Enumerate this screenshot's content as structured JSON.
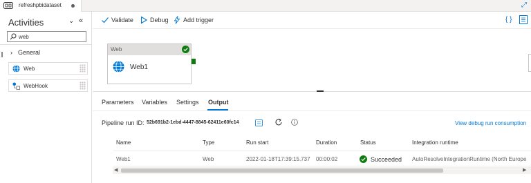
{
  "tab": {
    "title": "refreshpbidataset"
  },
  "activities": {
    "title": "Activities",
    "search_value": "web",
    "group_label": "General",
    "items": [
      {
        "label": "Web",
        "icon": "globe-icon"
      },
      {
        "label": "WebHook",
        "icon": "webhook-icon"
      }
    ]
  },
  "toolbar": {
    "validate_label": "Validate",
    "debug_label": "Debug",
    "add_trigger_label": "Add trigger"
  },
  "canvas": {
    "node_type": "Web",
    "node_name": "Web1",
    "node_status": "succeeded"
  },
  "bottom_tabs": [
    "Parameters",
    "Variables",
    "Settings",
    "Output"
  ],
  "active_tab": "Output",
  "output": {
    "run_id_label": "Pipeline run ID:",
    "run_id_value": "52b691b2-1ebd-4447-8845-62411e60fc14",
    "view_link": "View debug run consumption",
    "columns": {
      "name": "Name",
      "type": "Type",
      "run_start": "Run start",
      "duration": "Duration",
      "status": "Status",
      "ir": "Integration runtime"
    },
    "rows": [
      {
        "name": "Web1",
        "type": "Web",
        "run_start": "2022-01-18T17:39:15.737",
        "duration": "00:00:02",
        "status": "Succeeded",
        "ir": "AutoResolveIntegrationRuntime (North Europe"
      }
    ]
  },
  "colors": {
    "accent": "#0078d4",
    "success": "#107c10",
    "border": "#e1dfdd"
  }
}
